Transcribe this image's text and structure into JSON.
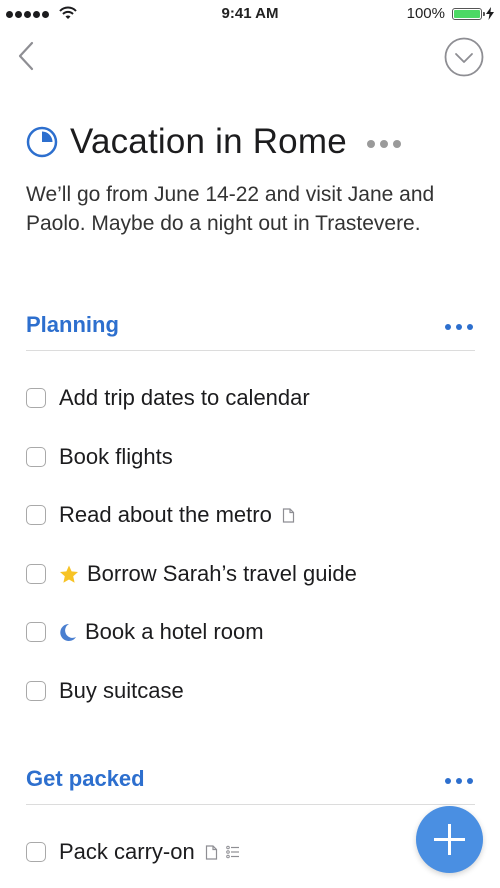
{
  "status_bar": {
    "time": "9:41 AM",
    "battery_percent": "100%",
    "battery_color": "#4cd964"
  },
  "nav": {
    "back_icon": "chevron-left-icon",
    "complete_icon": "checkmark-circle-icon"
  },
  "project": {
    "title": "Vacation in Rome",
    "progress_icon": "pie-progress-icon",
    "progress_fraction": 0.25,
    "notes": "We’ll go from June 14-22 and visit Jane and Paolo. Maybe do a night out in Trastevere."
  },
  "accent_color": "#2d6fce",
  "sections": [
    {
      "title": "Planning",
      "tasks": [
        {
          "label": "Add trip dates to calendar"
        },
        {
          "label": "Book flights"
        },
        {
          "label": "Read about the metro",
          "after_icons": [
            "note-icon"
          ]
        },
        {
          "label": "Borrow Sarah’s travel guide",
          "before_icon": "star-icon"
        },
        {
          "label": "Book a hotel room",
          "before_icon": "moon-icon"
        },
        {
          "label": "Buy suitcase"
        }
      ]
    },
    {
      "title": "Get packed",
      "tasks": [
        {
          "label": "Pack carry-on",
          "after_icons": [
            "note-icon",
            "checklist-icon"
          ]
        }
      ]
    }
  ],
  "fab": {
    "icon": "plus-icon"
  }
}
